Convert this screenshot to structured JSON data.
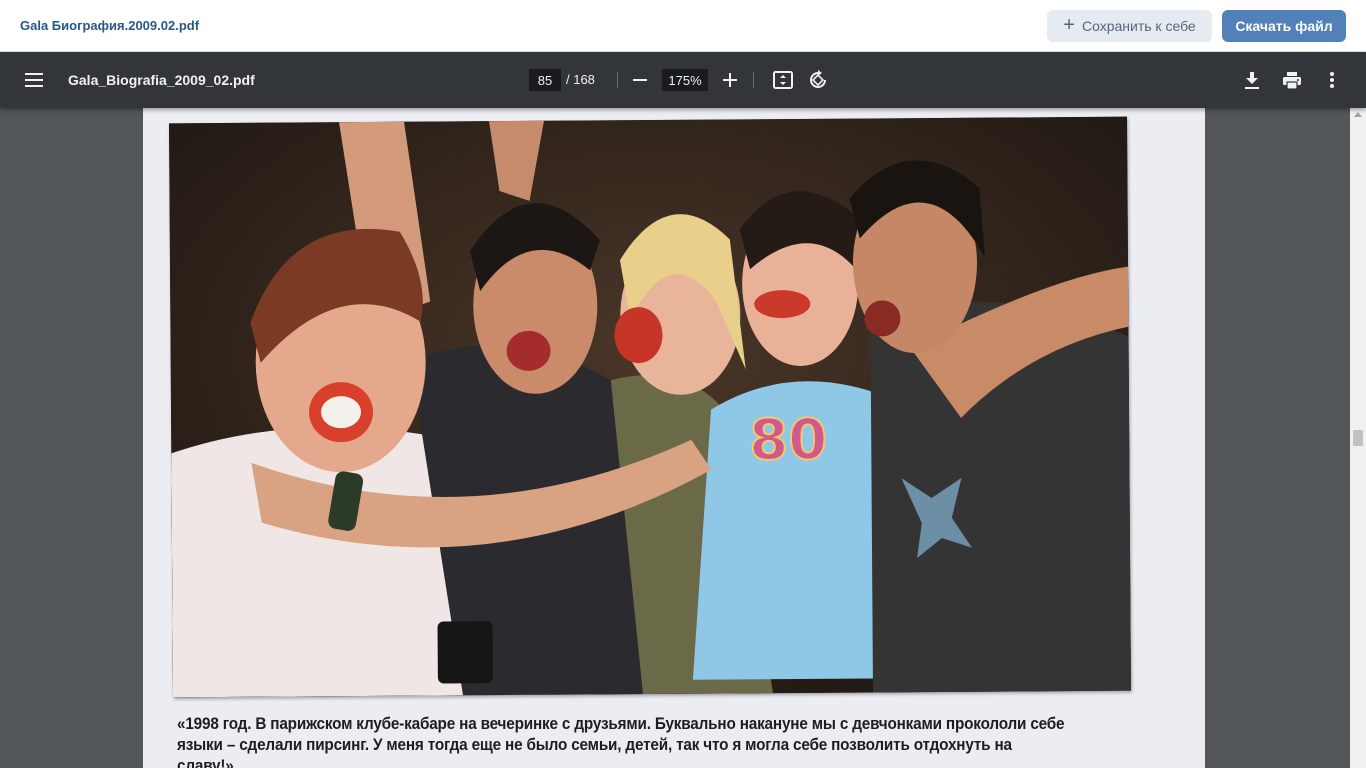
{
  "header": {
    "doc_name": "Gala Биография.2009.02.pdf",
    "save_label": "Сохранить к себе",
    "download_label": "Скачать файл"
  },
  "toolbar": {
    "file_name": "Gala_Biografia_2009_02.pdf",
    "current_page": "85",
    "total_pages": "/ 168",
    "zoom": "175%",
    "icons": [
      "menu-icon",
      "zoom-out-icon",
      "zoom-in-icon",
      "fit-page-icon",
      "rotate-icon",
      "download-icon",
      "print-icon",
      "more-options-icon"
    ]
  },
  "page": {
    "photo_alt": "80",
    "caption_line1": "«1998 год. В парижском клубе-кабаре на вечеринке с друзьями. Буквально накануне мы с девчонками прокололи себе",
    "caption_line2": "языки – сделали пирсинг. У меня тогда еще не было семьи, детей, так что я могла себе позволить отдохнуть на славу!»"
  },
  "colors": {
    "accent": "#5181b8",
    "toolbar_bg": "#323639",
    "viewer_bg": "#525659",
    "shirt_blue": "#8ec8e6"
  }
}
